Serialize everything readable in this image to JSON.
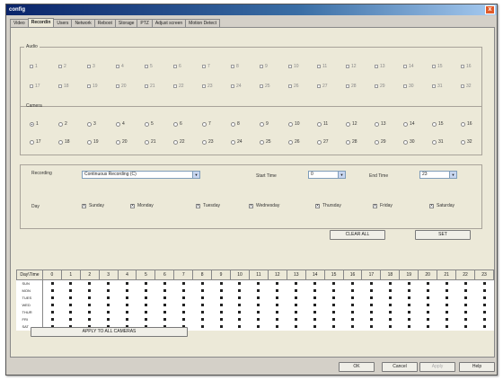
{
  "window": {
    "title": "config",
    "close_glyph": "x"
  },
  "tabs": [
    "Video",
    "Recordin",
    "Users",
    "Network",
    "Reboot",
    "Storage",
    "PTZ",
    "Adjust screen",
    "Motion Detect"
  ],
  "active_tab": 1,
  "audio": {
    "legend": "Audio",
    "row1": [
      "1",
      "2",
      "3",
      "4",
      "5",
      "6",
      "7",
      "8",
      "9",
      "10",
      "11",
      "12",
      "13",
      "14",
      "15",
      "16"
    ],
    "row2": [
      "17",
      "18",
      "19",
      "20",
      "21",
      "22",
      "23",
      "24",
      "25",
      "26",
      "27",
      "28",
      "29",
      "30",
      "31",
      "32"
    ]
  },
  "camera": {
    "legend": "Camera",
    "row1": [
      "1",
      "2",
      "3",
      "4",
      "5",
      "6",
      "7",
      "8",
      "9",
      "10",
      "11",
      "12",
      "13",
      "14",
      "15",
      "16"
    ],
    "row2": [
      "17",
      "18",
      "19",
      "20",
      "21",
      "22",
      "23",
      "24",
      "25",
      "26",
      "27",
      "28",
      "29",
      "30",
      "31",
      "32"
    ],
    "selected": "1"
  },
  "recording": {
    "label": "Recording",
    "value": "Continuous Recording (C)",
    "start_label": "Start Time",
    "start_value": "0",
    "end_label": "End Time",
    "end_value": "23"
  },
  "days": {
    "label": "Day",
    "items": [
      "Sunday",
      "Monday",
      "Tuesday",
      "Wednesday",
      "Thursday",
      "Friday",
      "Saturday"
    ],
    "checked_glyph": "x"
  },
  "buttons": {
    "clear_all": "CLEAR ALL",
    "set": "SET",
    "apply_all": "APPLY TO ALL CAMERAS"
  },
  "grid": {
    "corner": "Day\\Time",
    "hours": [
      "0",
      "1",
      "2",
      "3",
      "4",
      "5",
      "6",
      "7",
      "8",
      "9",
      "10",
      "11",
      "12",
      "13",
      "14",
      "15",
      "16",
      "17",
      "18",
      "19",
      "20",
      "21",
      "22",
      "23"
    ],
    "rows": [
      "SUN",
      "MON",
      "TUES",
      "WED",
      "THUR",
      "FRI",
      "SAT"
    ]
  },
  "footer": {
    "ok": "OK",
    "cancel": "Cancel",
    "apply": "Apply",
    "help": "Help"
  }
}
